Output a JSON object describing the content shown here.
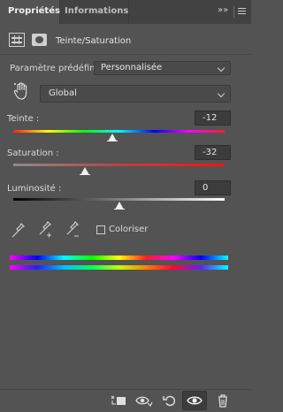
{
  "tabs": [
    {
      "label": "Propriétés",
      "active": true
    },
    {
      "label": "Informations",
      "active": false
    }
  ],
  "panel_menu": {
    "collapse_icon": "double-chevron-right-icon",
    "menu_icon": "hamburger-menu-icon"
  },
  "header": {
    "adjustment_icon": "hue-saturation-adjustment-icon",
    "mask_icon": "layer-mask-icon",
    "title": "Teinte/Saturation"
  },
  "preset": {
    "label": "Paramètre prédéfini :",
    "value": "Personnalisée"
  },
  "range": {
    "tool_icon": "targeted-adjustment-hand-icon",
    "value": "Global"
  },
  "sliders": [
    {
      "label": "Teinte :",
      "value": "-12",
      "min": -180,
      "max": 180,
      "level": -12
    },
    {
      "label": "Saturation :",
      "value": "-32",
      "min": -100,
      "max": 100,
      "level": -32
    },
    {
      "label": "Luminosité :",
      "value": "0",
      "min": -100,
      "max": 100,
      "level": 0
    }
  ],
  "tools": {
    "eyedropper_icon": "eyedropper-icon",
    "eyedropper_add_icon": "eyedropper-plus-icon",
    "eyedropper_subtract_icon": "eyedropper-minus-icon",
    "colorize_label": "Coloriser",
    "colorize_checked": false
  },
  "bottom_bar": [
    {
      "icon": "clip-to-layer-icon"
    },
    {
      "icon": "view-previous-state-icon"
    },
    {
      "icon": "reset-icon"
    },
    {
      "icon": "visibility-eye-icon"
    },
    {
      "icon": "trash-icon"
    }
  ],
  "colors": {
    "panel_bg": "#535353",
    "tabbar_bg": "#424242",
    "field_bg": "#3c3c3c",
    "select_bg": "#4a4a4a",
    "text": "#dcdcdc"
  }
}
